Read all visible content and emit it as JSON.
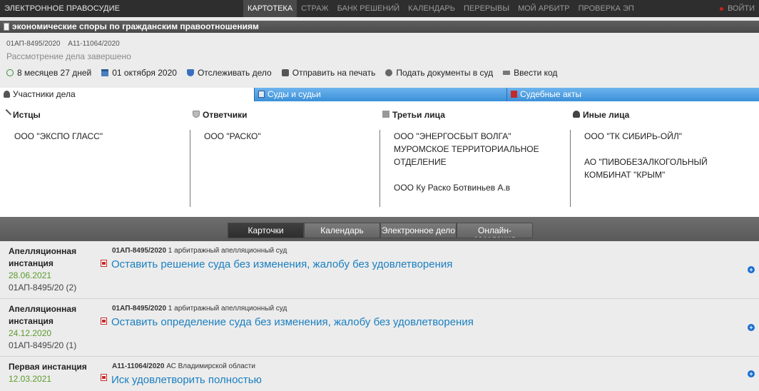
{
  "topbar": {
    "brand": "ЭЛЕКТРОННОЕ ПРАВОСУДИЕ",
    "nav": [
      "КАРТОТЕКА",
      "СТРАЖ",
      "БАНК РЕШЕНИЙ",
      "КАЛЕНДАРЬ",
      "ПЕРЕРЫВЫ",
      "МОЙ АРБИТР",
      "ПРОВЕРКА ЭП"
    ],
    "active_nav": "КАРТОТЕКА",
    "login": "ВОЙТИ"
  },
  "case": {
    "category": "экономические споры по гражданским правоотношениям",
    "numbers": [
      "01АП-8495/2020",
      "А11-11064/2020"
    ],
    "status": "Рассмотрение дела завершено",
    "actions": {
      "duration": "8 месяцев 27 дней",
      "date": "01 октября 2020",
      "track": "Отслеживать дело",
      "print": "Отправить на печать",
      "submit": "Подать документы в суд",
      "code": "Ввести код"
    }
  },
  "tabs": {
    "participants": "Участники дела",
    "courts": "Суды и судьи",
    "acts": "Судебные акты"
  },
  "participants": {
    "plaintiffs": {
      "title": "Истцы",
      "items": [
        "ООО \"ЭКСПО ГЛАСС\""
      ]
    },
    "defendants": {
      "title": "Ответчики",
      "items": [
        "ООО \"РАСКО\""
      ]
    },
    "third": {
      "title": "Третьи лица",
      "items": [
        "ООО \"ЭНЕРГОСБЫТ ВОЛГА\" МУРОМСКОЕ ТЕРРИТОРИАЛЬНОЕ ОТДЕЛЕНИЕ",
        "ООО Ку Раско Ботвиньев А.в"
      ]
    },
    "others": {
      "title": "Иные лица",
      "items": [
        "ООО \"ТК СИБИРЬ-ОЙЛ\"",
        "АО \"ПИВОБЕЗАЛКОГОЛЬНЫЙ КОМБИНАТ \"КРЫМ\""
      ]
    }
  },
  "lower_tabs": {
    "cards": "Карточки",
    "calendar": "Календарь",
    "electronic": "Электронное дело",
    "online": "Онлайн-заседания"
  },
  "documents": [
    {
      "instance": "Апелляционная инстанция",
      "date": "28.06.2021",
      "num": "01АП-8495/20 (2)",
      "case_num": "01АП-8495/2020",
      "court": "1 арбитражный апелляционный суд",
      "title": "Оставить решение суда без изменения, жалобу без удовлетворения"
    },
    {
      "instance": "Апелляционная инстанция",
      "date": "24.12.2020",
      "num": "01АП-8495/20 (1)",
      "case_num": "01АП-8495/2020",
      "court": "1 арбитражный апелляционный суд",
      "title": "Оставить определение суда без изменения, жалобу без удовлетворения"
    },
    {
      "instance": "Первая инстанция",
      "date": "12.03.2021",
      "num": "",
      "case_num": "А11-11064/2020",
      "court": "АС Владимирской области",
      "title": "Иск удовлетворить полностью"
    }
  ],
  "colors": {
    "topbar": "#2e2e2e",
    "tab_blue": "#3b8fd8",
    "link": "#1a7fc0",
    "date_green": "#5a9a2a",
    "login_dot": "#d02020"
  }
}
